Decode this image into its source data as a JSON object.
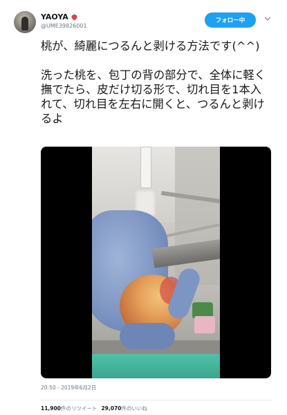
{
  "user": {
    "name": "YAOYA",
    "handle": "@UME39826001"
  },
  "follow_button": {
    "label": "フォロー中"
  },
  "tweet": {
    "paragraphs": [
      "桃が、綺麗につるんと剥ける方法です(^^)",
      "洗った桃を、包丁の背の部分で、全体に軽く撫でたら、皮だけ切る形で、切れ目を1本入れて、切れ目を左右に開くと、つるんと剥けるよ"
    ]
  },
  "timestamp": "20:50 - 2019年6月2日",
  "stats": {
    "retweet_count": "11,900",
    "retweet_label": "件のリツイート",
    "like_count": "29,070",
    "like_label": "件のいいね"
  },
  "colors": {
    "accent": "#1da1f2",
    "secondary_text": "#657786",
    "primary_text": "#14171a"
  },
  "icons": {
    "name_badge": "strawberry-icon",
    "menu": "chevron-down-icon"
  }
}
